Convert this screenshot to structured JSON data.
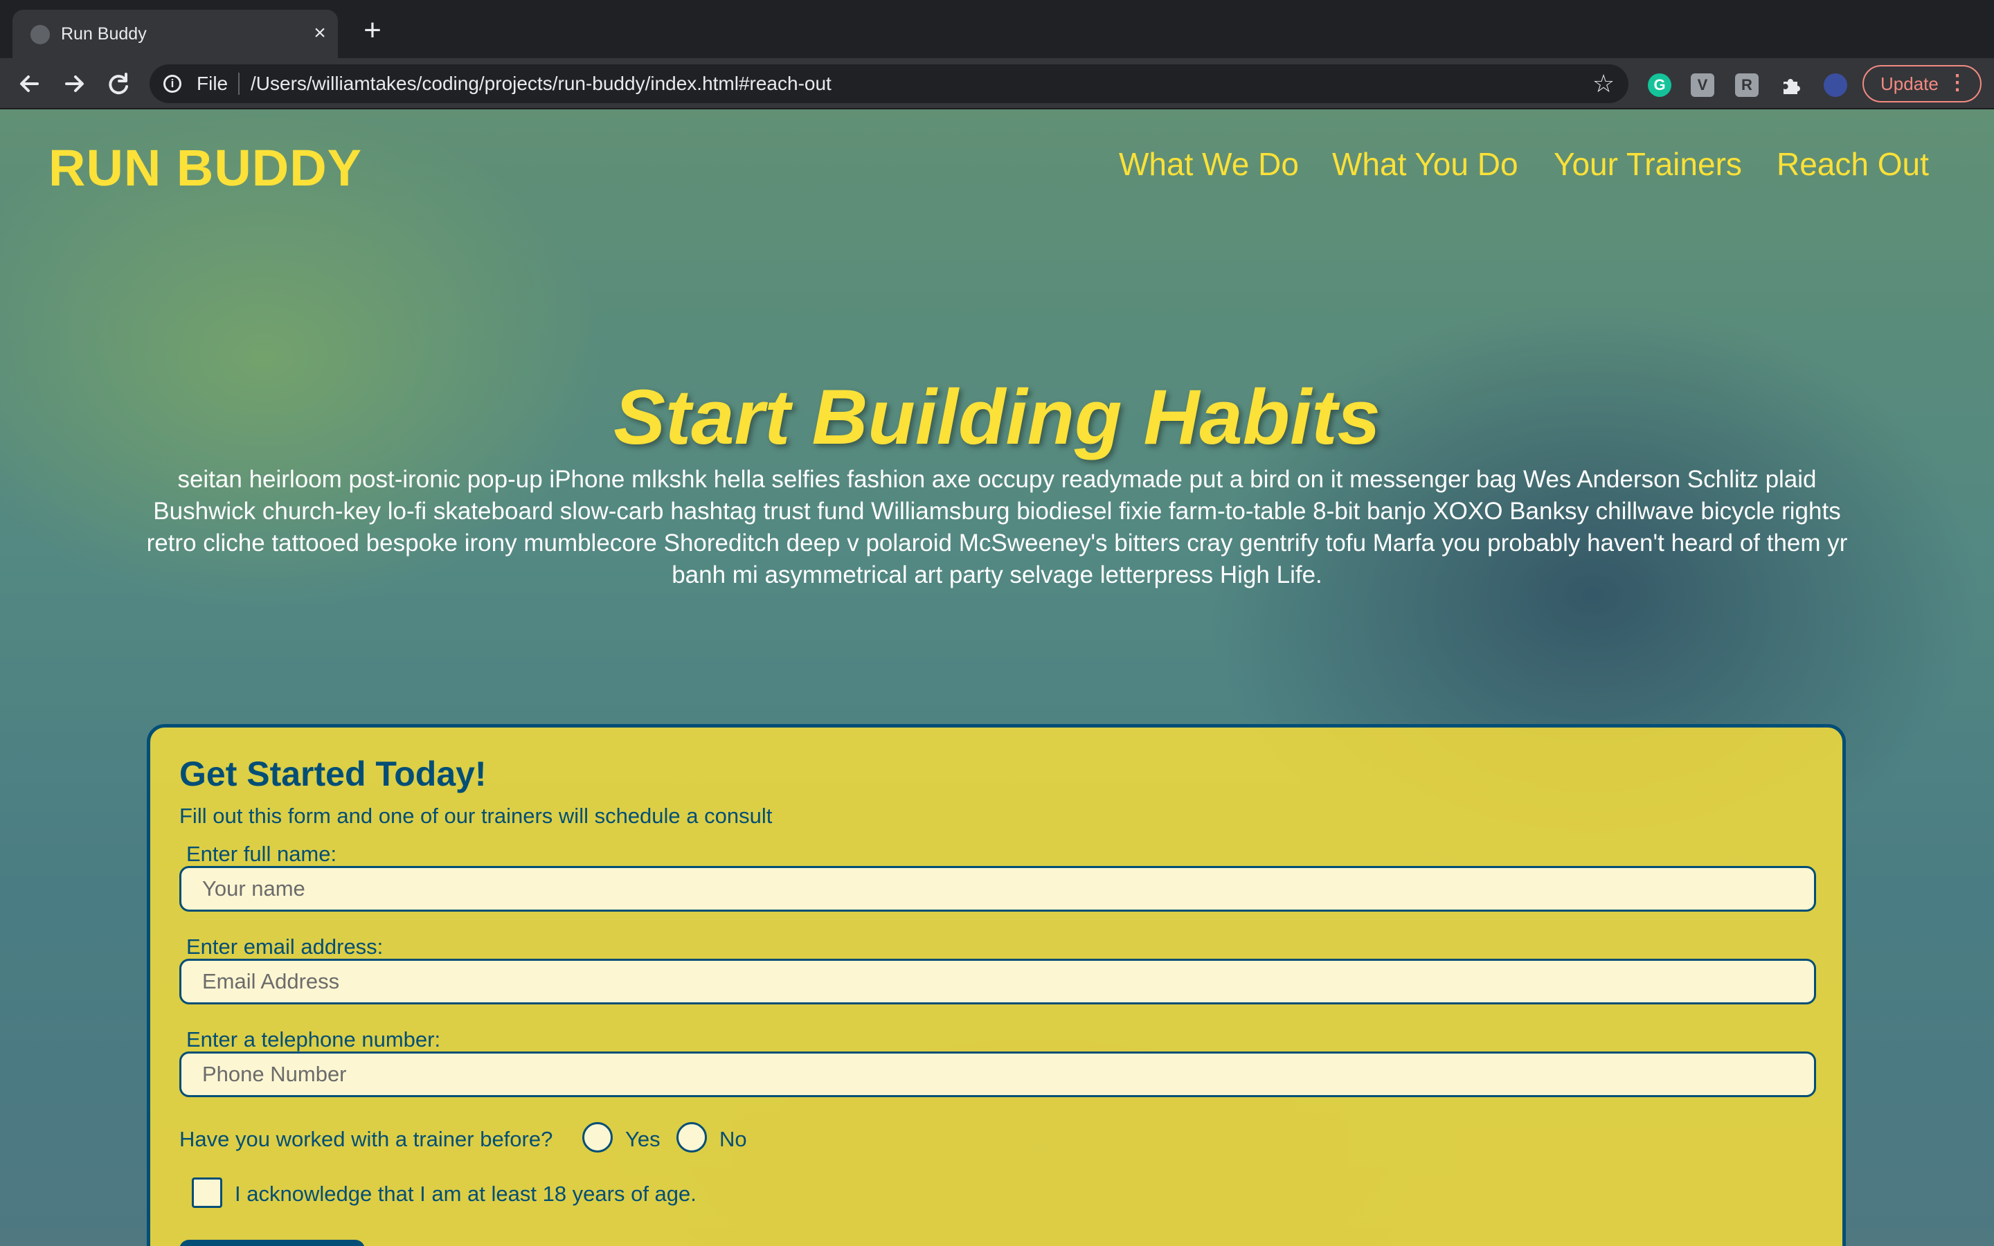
{
  "browser": {
    "tab_title": "Run Buddy",
    "tab_close": "×",
    "new_tab": "+",
    "scheme": "File",
    "url": "/Users/williamtakes/coding/projects/run-buddy/index.html#reach-out",
    "update_label": "Update",
    "extensions": [
      "grammarly-icon",
      "v-extension-icon",
      "r-extension-icon",
      "puzzle-extensions-icon",
      "profile-avatar"
    ]
  },
  "header": {
    "brand": "RUN BUDDY",
    "nav": [
      "What We Do",
      "What You Do",
      "Your Trainers",
      "Reach Out"
    ]
  },
  "hero": {
    "title": "Start Building Habits",
    "text": "seitan heirloom post-ironic pop-up iPhone mlkshk hella selfies fashion axe occupy readymade put a bird on it messenger bag Wes Anderson Schlitz plaid Bushwick church-key lo-fi skateboard slow-carb hashtag trust fund Williamsburg biodiesel fixie farm-to-table 8-bit banjo XOXO Banksy chillwave bicycle rights retro cliche tattooed bespoke irony mumblecore Shoreditch deep v polaroid McSweeney's bitters cray gentrify tofu Marfa you probably haven't heard of them yr banh mi asymmetrical art party selvage letterpress High Life."
  },
  "form": {
    "title": "Get Started Today!",
    "subtitle": "Fill out this form and one of our trainers will schedule a consult",
    "name_label": "Enter full name:",
    "name_placeholder": "Your name",
    "email_label": "Enter email address:",
    "email_placeholder": "Email Address",
    "phone_label": "Enter a telephone number:",
    "phone_placeholder": "Phone Number",
    "trainer_question": "Have you worked with a trainer before?",
    "yes_label": "Yes",
    "no_label": "No",
    "age_ack": "I acknowledge that I am at least 18 years of age."
  },
  "colors": {
    "brand_yellow": "#fce138",
    "brand_blue": "#024e76"
  }
}
